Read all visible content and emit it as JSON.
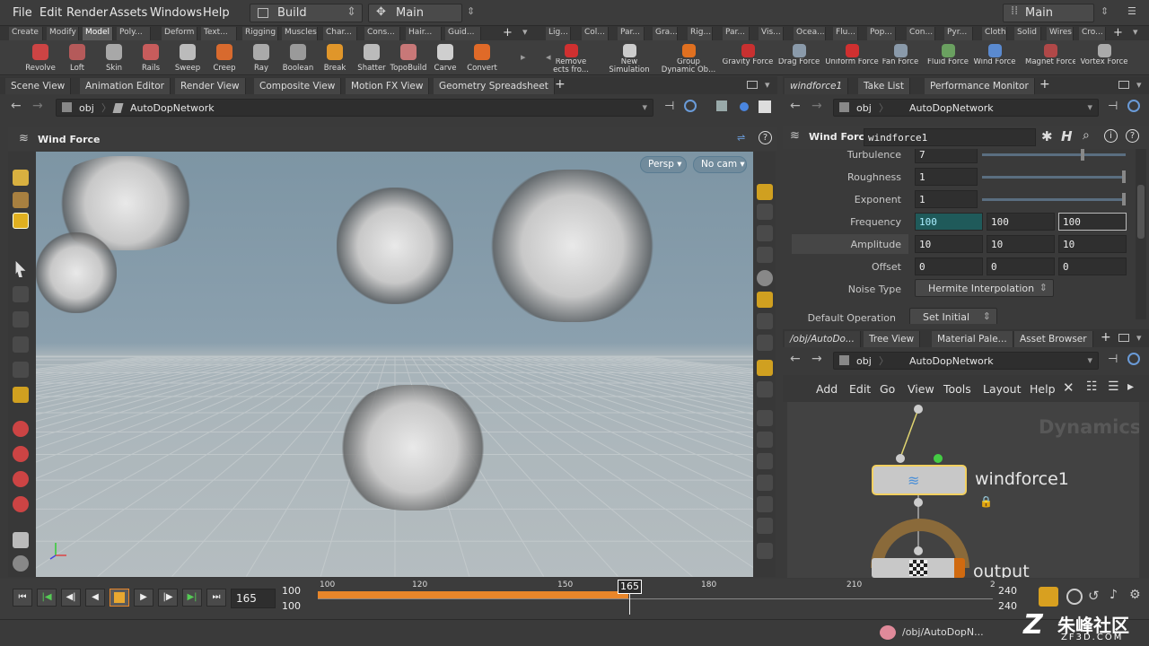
{
  "menubar": {
    "items": [
      "File",
      "Edit",
      "Render",
      "Assets",
      "Windows",
      "Help"
    ],
    "desktop": "Build",
    "context": "Main",
    "right_desktop": "Main"
  },
  "shelf_tabs_left": [
    "Create",
    "Modify",
    "Model",
    "Poly...",
    "Deform",
    "Text...",
    "Rigging",
    "Muscles",
    "Char...",
    "Cons...",
    "Hair...",
    "Guid..."
  ],
  "shelf_tabs_right": [
    "Lig...",
    "Col...",
    "Par...",
    "Gra...",
    "Rig...",
    "Par...",
    "Vis...",
    "Ocea...",
    "Flu...",
    "Pop...",
    "Con...",
    "Pyr...",
    "Cloth",
    "Solid",
    "Wires",
    "Cro..."
  ],
  "tools_left": [
    "Revolve",
    "Loft",
    "Skin",
    "Rails",
    "Sweep",
    "Creep",
    "Ray",
    "Boolean",
    "Break",
    "Shatter",
    "TopoBuild",
    "Carve",
    "Convert"
  ],
  "tools_right": [
    [
      "Remove",
      "ects fro..."
    ],
    [
      "New",
      "Simulation"
    ],
    [
      "Group",
      "Dynamic Ob..."
    ],
    [
      "Gravity Force",
      ""
    ],
    [
      "Drag Force",
      ""
    ],
    [
      "Uniform Force",
      ""
    ],
    [
      "Fan Force",
      ""
    ],
    [
      "Fluid Force",
      ""
    ],
    [
      "Wind Force",
      ""
    ],
    [
      "Magnet Force",
      ""
    ],
    [
      "Vortex Force",
      ""
    ]
  ],
  "left_pane": {
    "tabs": [
      "Scene View",
      "Animation Editor",
      "Render View",
      "Composite View",
      "Motion FX View",
      "Geometry Spreadsheet"
    ],
    "path_root": "obj",
    "path_node": "AutoDopNetwork",
    "title": "Wind Force",
    "persp": "Persp",
    "cam": "No cam"
  },
  "param_pane": {
    "tabs": [
      "windforce1",
      "Take List",
      "Performance Monitor"
    ],
    "path_root": "obj",
    "path_node": "AutoDopNetwork",
    "node_type": "Wind Force",
    "node_name": "windforce1",
    "rows": [
      {
        "label": "Turbulence",
        "v": [
          "7"
        ]
      },
      {
        "label": "Roughness",
        "v": [
          "1"
        ]
      },
      {
        "label": "Exponent",
        "v": [
          "1"
        ]
      },
      {
        "label": "Frequency",
        "v": [
          "100",
          "100",
          "100"
        ]
      },
      {
        "label": "Amplitude",
        "v": [
          "10",
          "10",
          "10"
        ]
      },
      {
        "label": "Offset",
        "v": [
          "0",
          "0",
          "0"
        ]
      }
    ],
    "noise_label": "Noise Type",
    "noise_value": "Hermite Interpolation",
    "default_label": "Default Operation",
    "default_value": "Set Initial"
  },
  "net_pane": {
    "tabs": [
      "/obj/AutoDo...",
      "Tree View",
      "Material Pale...",
      "Asset Browser"
    ],
    "path_root": "obj",
    "path_node": "AutoDopNetwork",
    "menu": [
      "Add",
      "Edit",
      "Go",
      "View",
      "Tools",
      "Layout",
      "Help"
    ],
    "watermark": "Dynamics",
    "node_name": "windforce1",
    "output_name": "output"
  },
  "timeline": {
    "current": "165",
    "start": "100",
    "end": "100",
    "range_start": "240",
    "range_end": "240",
    "ticks": [
      "100",
      "120",
      "150",
      "165",
      "180",
      "210",
      "2"
    ]
  },
  "status": {
    "path": "/obj/AutoDopN...",
    "watermark": "朱峰社区",
    "watermark_sub": "ZF3D.COM"
  },
  "colors": {
    "accent_orange": "#e8862a",
    "node_select": "#f2d060",
    "bg": "#3a3a3a"
  }
}
